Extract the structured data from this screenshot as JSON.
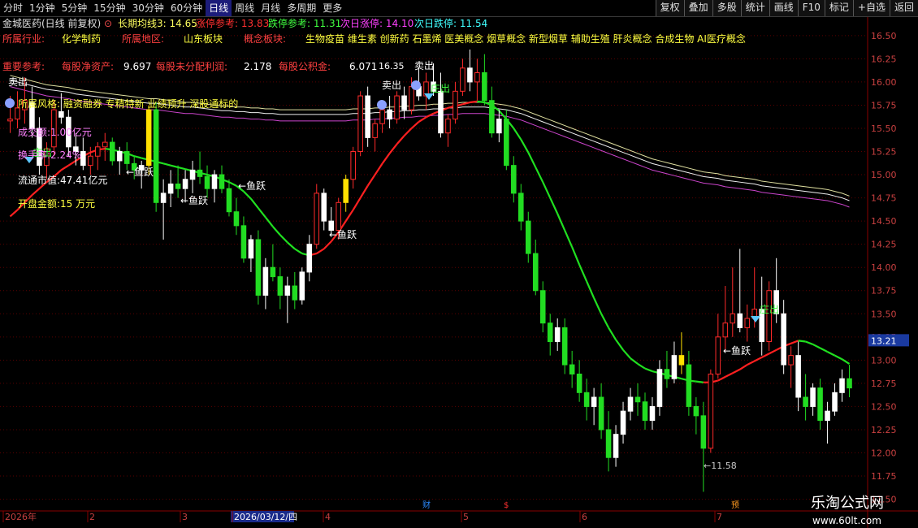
{
  "toolbar": {
    "periods": [
      "分时",
      "1分钟",
      "5分钟",
      "15分钟",
      "30分钟",
      "60分钟",
      "日线",
      "周线",
      "月线",
      "多周期",
      "更多"
    ],
    "active_period": "日线",
    "buttons": [
      "复权",
      "叠加",
      "多股",
      "统计",
      "画线",
      "F10",
      "标记",
      "+自选",
      "返回"
    ]
  },
  "header": {
    "stock": "金城医药(日线 前复权)",
    "ma_label": "长期均线3: 14.65",
    "limit_up_ref": "涨停参考: 13.83",
    "limit_down_ref": "跌停参考: 11.31",
    "next_up": "次日涨停: 14.10",
    "next_down": "次日跌停: 11.54"
  },
  "info": {
    "industry_label": "所属行业:",
    "industry": "化学制药",
    "region_label": "所属地区:",
    "region": "山东板块",
    "concept_label": "概念板块:",
    "concepts": "生物疫苗 维生素 创新药 石墨烯 医美概念 烟草概念 新型烟草 辅助生殖 肝炎概念 合成生物 AI医疗概念",
    "ref_label": "重要参考:",
    "nav_label": "每股净资产:",
    "nav": "9.697",
    "undist_label": "每股未分配利润:",
    "undist": "2.178",
    "reserve_label": "每股公积金:",
    "reserve": "6.071",
    "style": "所属风格: 融资融券 专精特新 业绩预升 深股通标的",
    "turnover_amount": "成交额:1.00亿元",
    "turnover_rate": "换手率:2.24%",
    "float_cap": "流通市值:47.41亿元",
    "open_amount": "开盘金额:15 万元"
  },
  "watermark": {
    "title": "乐淘公式网",
    "url": "www.60lt.com"
  },
  "chart_data": {
    "type": "candlestick",
    "ylim": [
      11.4,
      16.7
    ],
    "yticks": [
      "16.50",
      "16.25",
      "16.00",
      "15.75",
      "15.50",
      "15.25",
      "15.00",
      "14.75",
      "14.50",
      "14.25",
      "14.00",
      "13.75",
      "13.50",
      "13.25",
      "13.00",
      "12.75",
      "12.50",
      "12.25",
      "12.00",
      "11.75",
      "11.50"
    ],
    "last_price": "13.21",
    "x_labels": [
      "2026年",
      "2",
      "3",
      "2026/03/12/四",
      "4",
      "5",
      "6",
      "7"
    ],
    "event_markers": [
      "财",
      "$",
      "预"
    ],
    "annotations": {
      "sell": "卖出",
      "fish": "←鱼跃",
      "zhuang": "庄出",
      "high": "16.35",
      "low": "←11.58"
    },
    "ohlc": [
      [
        15.58,
        15.85,
        15.45,
        15.6
      ],
      [
        15.6,
        15.9,
        15.5,
        15.72
      ],
      [
        15.7,
        16.05,
        15.55,
        15.8
      ],
      [
        15.78,
        15.95,
        15.4,
        15.5
      ],
      [
        15.5,
        15.62,
        15.0,
        15.1
      ],
      [
        15.1,
        15.35,
        14.95,
        15.28
      ],
      [
        15.3,
        15.8,
        15.2,
        15.7
      ],
      [
        15.68,
        15.88,
        15.55,
        15.62
      ],
      [
        15.62,
        15.7,
        15.2,
        15.3
      ],
      [
        15.3,
        15.45,
        15.1,
        15.25
      ],
      [
        15.25,
        15.4,
        15.05,
        15.1
      ],
      [
        15.1,
        15.3,
        15.0,
        15.2
      ],
      [
        15.2,
        15.35,
        15.05,
        15.3
      ],
      [
        15.3,
        15.45,
        15.15,
        15.35
      ],
      [
        15.35,
        15.4,
        15.1,
        15.15
      ],
      [
        15.15,
        15.3,
        15.0,
        15.25
      ],
      [
        15.25,
        15.35,
        15.05,
        15.12
      ],
      [
        15.12,
        15.2,
        14.95,
        15.05
      ],
      [
        15.05,
        15.15,
        14.85,
        15.1
      ],
      [
        15.1,
        15.75,
        15.0,
        15.7
      ],
      [
        15.7,
        15.78,
        14.6,
        14.7
      ],
      [
        14.7,
        14.95,
        14.3,
        14.8
      ],
      [
        14.8,
        15.05,
        14.65,
        14.9
      ],
      [
        14.9,
        15.1,
        14.75,
        14.85
      ],
      [
        14.85,
        15.05,
        14.7,
        14.95
      ],
      [
        14.95,
        15.15,
        14.8,
        15.05
      ],
      [
        15.05,
        15.25,
        14.9,
        14.98
      ],
      [
        14.98,
        15.1,
        14.75,
        14.85
      ],
      [
        14.85,
        15.05,
        14.7,
        15.0
      ],
      [
        15.0,
        15.1,
        14.8,
        14.85
      ],
      [
        14.85,
        14.95,
        14.55,
        14.6
      ],
      [
        14.6,
        14.75,
        14.35,
        14.45
      ],
      [
        14.45,
        14.55,
        14.05,
        14.1
      ],
      [
        14.1,
        14.35,
        13.95,
        14.3
      ],
      [
        14.3,
        14.4,
        13.6,
        13.7
      ],
      [
        13.7,
        14.1,
        13.55,
        14.0
      ],
      [
        14.0,
        14.25,
        13.85,
        13.9
      ],
      [
        13.9,
        14.0,
        13.55,
        13.7
      ],
      [
        13.7,
        13.9,
        13.4,
        13.8
      ],
      [
        13.8,
        13.95,
        13.55,
        13.65
      ],
      [
        13.65,
        14.0,
        13.6,
        13.95
      ],
      [
        13.95,
        14.35,
        13.85,
        14.25
      ],
      [
        14.25,
        14.9,
        14.2,
        14.8
      ],
      [
        14.8,
        14.85,
        14.4,
        14.5
      ],
      [
        14.5,
        14.65,
        14.35,
        14.4
      ],
      [
        14.4,
        14.75,
        14.3,
        14.7
      ],
      [
        14.7,
        15.0,
        14.6,
        14.95
      ],
      [
        14.95,
        15.3,
        14.85,
        15.25
      ],
      [
        15.25,
        15.9,
        15.2,
        15.85
      ],
      [
        15.85,
        15.95,
        15.3,
        15.4
      ],
      [
        15.4,
        15.6,
        15.25,
        15.55
      ],
      [
        15.55,
        15.8,
        15.45,
        15.7
      ],
      [
        15.7,
        15.85,
        15.5,
        15.6
      ],
      [
        15.6,
        15.9,
        15.55,
        15.85
      ],
      [
        15.85,
        15.95,
        15.6,
        15.7
      ],
      [
        15.7,
        16.05,
        15.65,
        15.95
      ],
      [
        15.95,
        16.15,
        15.8,
        15.85
      ],
      [
        15.85,
        16.1,
        15.7,
        16.0
      ],
      [
        16.0,
        16.2,
        15.85,
        15.9
      ],
      [
        15.9,
        16.1,
        15.4,
        15.45
      ],
      [
        15.45,
        15.65,
        15.3,
        15.6
      ],
      [
        15.6,
        16.0,
        15.55,
        15.9
      ],
      [
        15.9,
        16.25,
        15.85,
        16.15
      ],
      [
        16.15,
        16.35,
        15.9,
        16.0
      ],
      [
        16.0,
        16.25,
        15.8,
        16.1
      ],
      [
        16.1,
        16.3,
        15.75,
        15.8
      ],
      [
        15.8,
        15.95,
        15.4,
        15.45
      ],
      [
        15.45,
        15.7,
        15.35,
        15.6
      ],
      [
        15.6,
        15.7,
        15.05,
        15.1
      ],
      [
        15.1,
        15.2,
        14.7,
        14.8
      ],
      [
        14.8,
        14.9,
        14.4,
        14.5
      ],
      [
        14.5,
        14.6,
        14.05,
        14.15
      ],
      [
        14.15,
        14.3,
        13.7,
        13.75
      ],
      [
        13.75,
        13.85,
        13.3,
        13.4
      ],
      [
        13.4,
        13.5,
        13.05,
        13.2
      ],
      [
        13.2,
        13.45,
        13.1,
        13.35
      ],
      [
        13.35,
        13.45,
        12.85,
        12.95
      ],
      [
        12.95,
        13.1,
        12.7,
        12.85
      ],
      [
        12.85,
        13.0,
        12.55,
        12.65
      ],
      [
        12.65,
        12.8,
        12.35,
        12.5
      ],
      [
        12.5,
        12.7,
        12.3,
        12.6
      ],
      [
        12.6,
        12.75,
        12.15,
        12.25
      ],
      [
        12.25,
        12.45,
        11.8,
        11.95
      ],
      [
        11.95,
        12.3,
        11.85,
        12.2
      ],
      [
        12.2,
        12.55,
        12.1,
        12.45
      ],
      [
        12.45,
        12.7,
        12.35,
        12.6
      ],
      [
        12.6,
        12.75,
        12.4,
        12.55
      ],
      [
        12.55,
        12.65,
        12.25,
        12.35
      ],
      [
        12.35,
        12.6,
        12.25,
        12.5
      ],
      [
        12.5,
        13.0,
        12.4,
        12.9
      ],
      [
        12.9,
        13.1,
        12.7,
        12.8
      ],
      [
        12.8,
        13.2,
        12.75,
        13.05
      ],
      [
        13.05,
        13.3,
        12.85,
        12.95
      ],
      [
        12.95,
        13.1,
        12.4,
        12.5
      ],
      [
        12.5,
        12.6,
        12.2,
        12.4
      ],
      [
        12.4,
        12.55,
        11.58,
        12.05
      ],
      [
        12.05,
        12.9,
        12.0,
        12.85
      ],
      [
        12.85,
        13.5,
        12.8,
        13.25
      ],
      [
        13.25,
        13.8,
        13.1,
        13.4
      ],
      [
        13.4,
        14.0,
        13.25,
        13.5
      ],
      [
        13.5,
        14.2,
        13.3,
        13.35
      ],
      [
        13.35,
        13.6,
        13.2,
        13.45
      ],
      [
        13.45,
        14.0,
        13.35,
        13.55
      ],
      [
        13.55,
        13.9,
        13.05,
        13.2
      ],
      [
        13.2,
        13.85,
        13.1,
        13.75
      ],
      [
        13.75,
        14.1,
        13.4,
        13.5
      ],
      [
        13.5,
        13.65,
        12.85,
        12.95
      ],
      [
        12.95,
        13.15,
        12.7,
        13.05
      ],
      [
        13.05,
        13.2,
        12.45,
        12.6
      ],
      [
        12.6,
        12.85,
        12.35,
        12.5
      ],
      [
        12.5,
        12.75,
        12.4,
        12.7
      ],
      [
        12.7,
        12.8,
        12.25,
        12.35
      ],
      [
        12.35,
        12.55,
        12.1,
        12.45
      ],
      [
        12.45,
        12.75,
        12.4,
        12.65
      ],
      [
        12.65,
        12.9,
        12.55,
        12.8
      ],
      [
        12.8,
        12.95,
        12.6,
        12.7
      ]
    ],
    "ma_long": [
      15.95,
      15.93,
      15.91,
      15.89,
      15.87,
      15.85,
      15.84,
      15.83,
      15.82,
      15.8,
      15.79,
      15.78,
      15.77,
      15.76,
      15.75,
      15.74,
      15.73,
      15.72,
      15.71,
      15.7,
      15.7,
      15.69,
      15.68,
      15.67,
      15.66,
      15.66,
      15.65,
      15.64,
      15.63,
      15.62,
      15.62,
      15.61,
      15.61,
      15.6,
      15.6,
      15.59,
      15.59,
      15.58,
      15.58,
      15.58,
      15.58,
      15.58,
      15.58,
      15.58,
      15.58,
      15.58,
      15.58,
      15.59,
      15.59,
      15.59,
      15.6,
      15.6,
      15.61,
      15.61,
      15.62,
      15.62,
      15.63,
      15.63,
      15.64,
      15.64,
      15.65,
      15.65,
      15.66,
      15.66,
      15.66,
      15.66,
      15.65,
      15.64,
      15.63,
      15.61,
      15.59,
      15.56,
      15.53,
      15.5,
      15.47,
      15.44,
      15.41,
      15.38,
      15.35,
      15.32,
      15.29,
      15.26,
      15.23,
      15.2,
      15.17,
      15.14,
      15.11,
      15.08,
      15.05,
      15.03,
      15.01,
      14.99,
      14.97,
      14.95,
      14.93,
      14.91,
      14.9,
      14.89,
      14.87,
      14.86,
      14.85,
      14.84,
      14.83,
      14.81,
      14.8,
      14.79,
      14.78,
      14.77,
      14.76,
      14.75,
      14.74,
      14.73,
      14.72,
      14.7,
      14.68,
      14.65
    ],
    "ma_trend": [
      14.55,
      14.62,
      14.7,
      14.78,
      14.85,
      14.92,
      14.98,
      15.05,
      15.1,
      15.15,
      15.2,
      15.24,
      15.27,
      15.28,
      15.27,
      15.25,
      15.23,
      15.2,
      15.18,
      15.16,
      15.14,
      15.12,
      15.1,
      15.08,
      15.06,
      15.04,
      15.02,
      15.0,
      14.98,
      14.95,
      14.92,
      14.88,
      14.82,
      14.74,
      14.64,
      14.54,
      14.44,
      14.35,
      14.27,
      14.2,
      14.15,
      14.13,
      14.15,
      14.2,
      14.28,
      14.38,
      14.5,
      14.62,
      14.75,
      14.88,
      15.0,
      15.12,
      15.23,
      15.33,
      15.42,
      15.5,
      15.57,
      15.62,
      15.66,
      15.69,
      15.72,
      15.74,
      15.76,
      15.78,
      15.79,
      15.78,
      15.75,
      15.69,
      15.6,
      15.5,
      15.38,
      15.24,
      15.08,
      14.92,
      14.75,
      14.58,
      14.4,
      14.22,
      14.03,
      13.85,
      13.67,
      13.5,
      13.35,
      13.22,
      13.11,
      13.02,
      12.96,
      12.91,
      12.88,
      12.86,
      12.84,
      12.82,
      12.8,
      12.78,
      12.77,
      12.76,
      12.76,
      12.78,
      12.82,
      12.86,
      12.9,
      12.95,
      12.99,
      13.03,
      13.07,
      13.11,
      13.15,
      13.18,
      13.21,
      13.2,
      13.17,
      13.13,
      13.09,
      13.05,
      13.01,
      12.96
    ]
  }
}
